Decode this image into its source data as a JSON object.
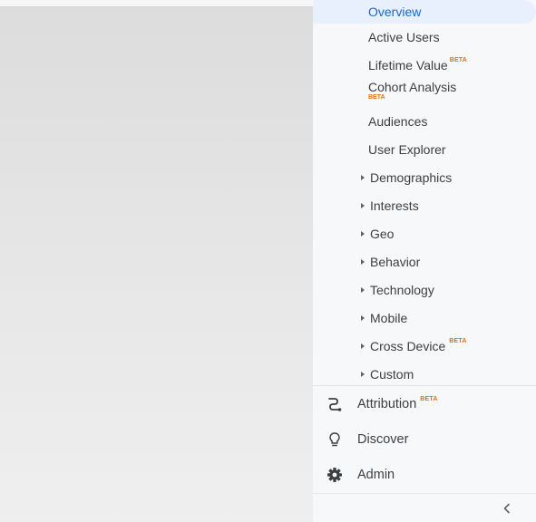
{
  "sidebar": {
    "audience_items": [
      {
        "label": "Overview",
        "active": true
      },
      {
        "label": "Active Users"
      },
      {
        "label": "Lifetime Value",
        "badge": "BETA"
      },
      {
        "label": "Cohort Analysis",
        "badge": "BETA"
      },
      {
        "label": "Audiences"
      },
      {
        "label": "User Explorer"
      }
    ],
    "expandable_items": [
      {
        "label": "Demographics"
      },
      {
        "label": "Interests"
      },
      {
        "label": "Geo"
      },
      {
        "label": "Behavior"
      },
      {
        "label": "Technology"
      },
      {
        "label": "Mobile"
      },
      {
        "label": "Cross Device",
        "badge": "BETA"
      },
      {
        "label": "Custom"
      }
    ],
    "main_items": [
      {
        "label": "Attribution",
        "badge": "BETA",
        "icon": "attribution-icon"
      },
      {
        "label": "Discover",
        "icon": "lightbulb-icon"
      },
      {
        "label": "Admin",
        "icon": "gear-icon"
      }
    ],
    "collapse_icon": "chevron-left-icon"
  },
  "colors": {
    "active_bg": "#e8f0fe",
    "active_text": "#1967d2",
    "beta": "#e8710a",
    "text": "#3c4043"
  }
}
